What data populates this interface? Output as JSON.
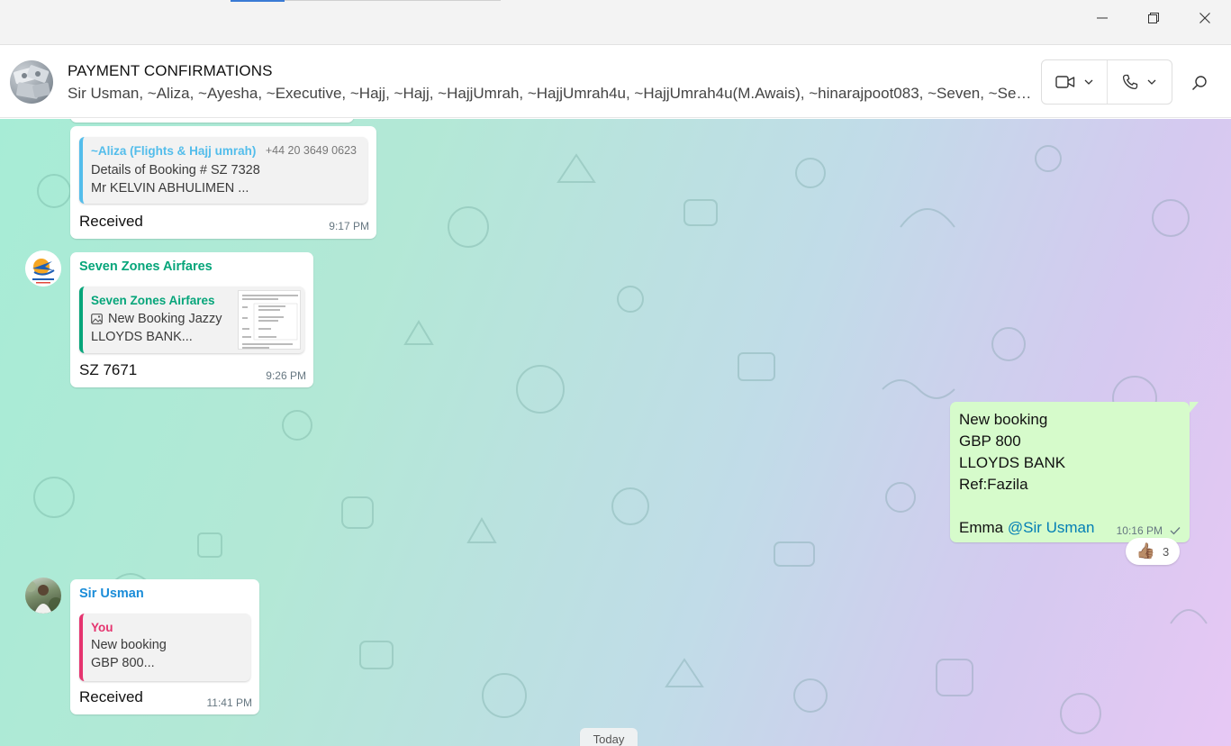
{
  "window": {
    "controls": [
      "minimize-icon",
      "restore-icon",
      "close-icon"
    ]
  },
  "header": {
    "title": "PAYMENT CONFIRMATIONS",
    "members": "Sir Usman, ~Aliza, ~Ayesha, ~Executive, ~Hajj, ~Hajj, ~HajjUmrah, ~HajjUmrah4u, ~HajjUmrah4u(M.Awais), ~hinarajpoot083, ~Seven, ~Seven Zones Airfares",
    "video_icon": "video-camera-icon",
    "call_icon": "phone-icon",
    "search_icon": "search-icon"
  },
  "messages": [
    {
      "quote": {
        "name": "~Aliza (Flights & Hajj umrah)",
        "phone": "+44 20 3649 0623",
        "line1": "Details of Booking # SZ 7328",
        "line2": "Mr KELVIN ABHULIMEN      ..."
      },
      "text": "Received",
      "time": "9:17 PM"
    },
    {
      "sender": "Seven Zones Airfares",
      "sender_color": "#06a57a",
      "quote": {
        "name": "Seven Zones Airfares",
        "line1": "New Booking Jazzy",
        "line2": "LLOYDS BANK..."
      },
      "text": "SZ 7671",
      "time": "9:26 PM"
    },
    {
      "outgoing": true,
      "lines": [
        "New booking",
        "GBP 800",
        "LLOYDS BANK",
        "Ref:Fazila"
      ],
      "signature": "Emma",
      "mention": "@Sir Usman",
      "time": "10:16 PM",
      "status_icon": "check-icon",
      "reaction": {
        "emoji": "👍🏽",
        "count": "3"
      }
    },
    {
      "sender": "Sir Usman",
      "sender_color": "#1a8cd8",
      "quote": {
        "name": "You",
        "line1": "New booking",
        "line2": "GBP 800..."
      },
      "text": "Received",
      "time": "11:41 PM"
    }
  ],
  "day_divider": "Today",
  "colors": {
    "outgoing_bubble": "#d6fbcb",
    "mention": "#027eb5",
    "aliza_name": "#53bdeb",
    "seven_zones": "#06a57a",
    "you_name": "#e5346f"
  }
}
